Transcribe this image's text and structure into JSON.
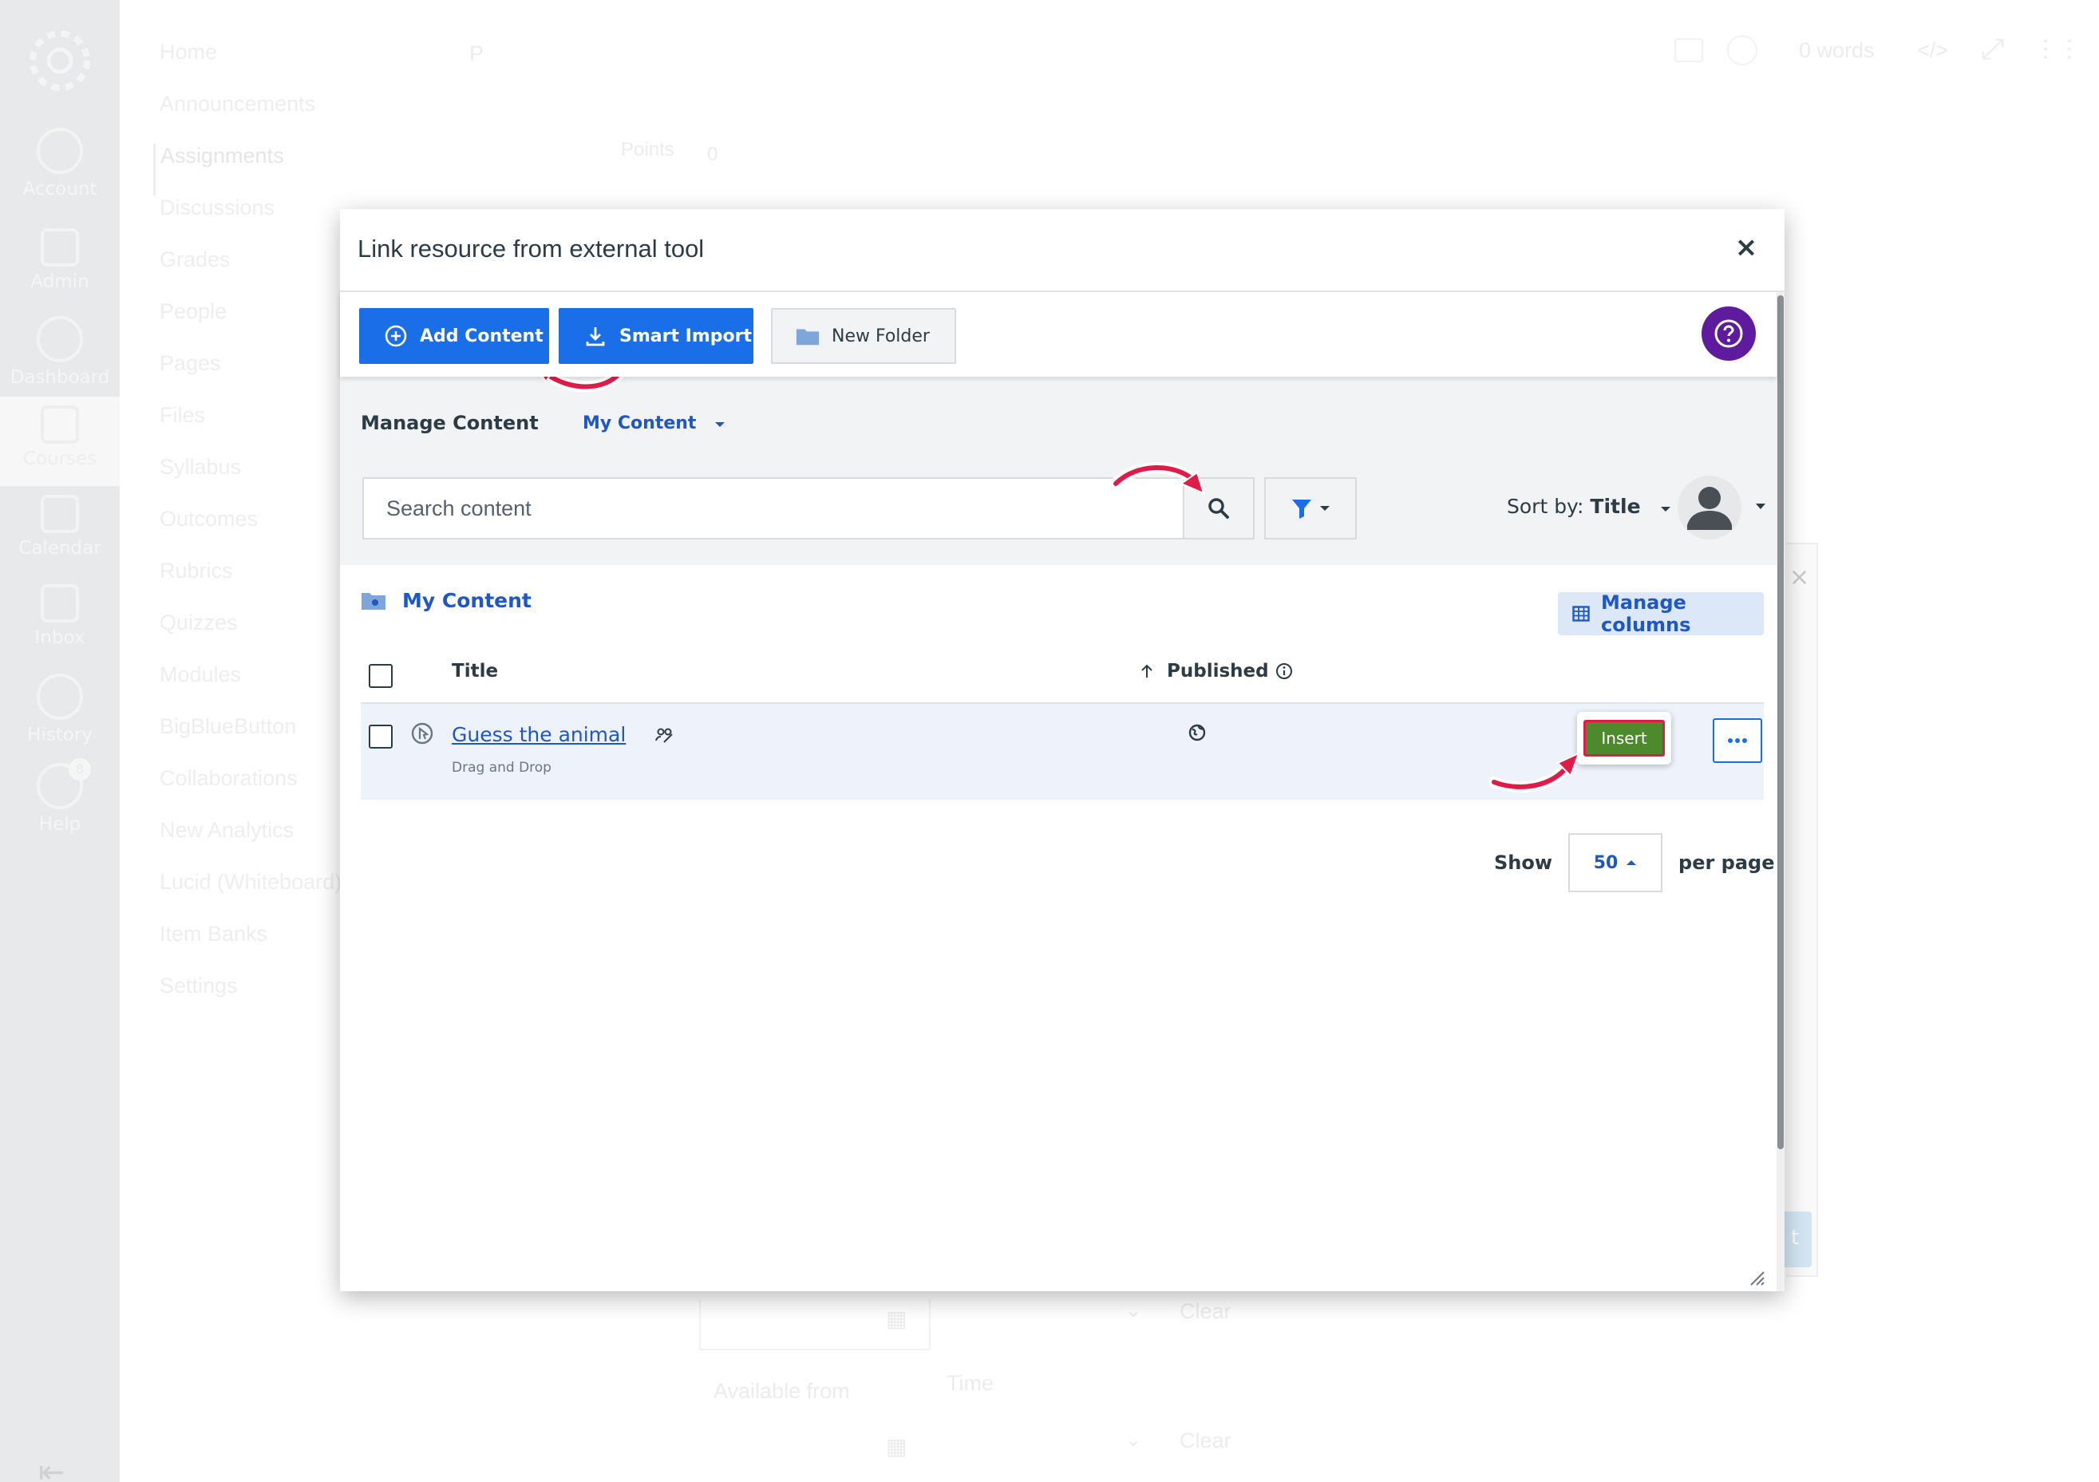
{
  "background": {
    "global_nav": [
      "Account",
      "Admin",
      "Dashboard",
      "Courses",
      "Calendar",
      "Inbox",
      "History",
      "Help"
    ],
    "help_badge": "8",
    "course_nav": [
      "Home",
      "Announcements",
      "Assignments",
      "Discussions",
      "Grades",
      "People",
      "Pages",
      "Files",
      "Syllabus",
      "Outcomes",
      "Rubrics",
      "Quizzes",
      "Modules",
      "BigBlueButton",
      "Collaborations",
      "New Analytics",
      "Lucid (Whiteboard)",
      "Item Banks",
      "Settings"
    ],
    "editor_p": "P",
    "points_label": "Points",
    "points_value": "0",
    "word_count": "0 words",
    "html_toggle": "</>",
    "clear_1": "Clear",
    "clear_2": "Clear",
    "available_from": "Available from",
    "time_label": "Time",
    "side_btn_fragment": "t"
  },
  "modal": {
    "title": "Link resource from external tool",
    "close_label": "×",
    "toolbar": {
      "add_content": "Add Content",
      "smart_import": "Smart Import",
      "new_folder": "New Folder"
    },
    "manage_label": "Manage Content",
    "content_scope": "My Content",
    "search": {
      "placeholder": "Search content"
    },
    "sort_prefix": "Sort by:",
    "sort_value": "Title",
    "breadcrumb_folder": "My Content",
    "manage_columns": "Manage columns",
    "table": {
      "columns": [
        "Title",
        "Published"
      ],
      "rows": [
        {
          "title": "Guess the animal",
          "type": "Drag and Drop",
          "insert": "Insert"
        }
      ]
    },
    "pager": {
      "show": "Show",
      "value": "50",
      "per_page": "per page"
    }
  },
  "colors": {
    "primary": "#1a6fe8",
    "link": "#1f57c3",
    "insert_green": "#4d8a2d",
    "highlight_red": "#e11b48",
    "help_purple": "#5f1b9e"
  }
}
